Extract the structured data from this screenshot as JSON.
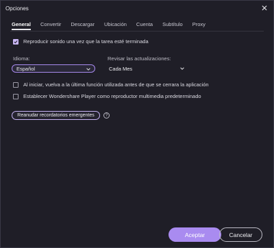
{
  "window": {
    "title": "Opciones",
    "close_icon": "close-icon"
  },
  "tabs": [
    {
      "label": "General",
      "active": true
    },
    {
      "label": "Convertir"
    },
    {
      "label": "Descargar"
    },
    {
      "label": "Ubicación"
    },
    {
      "label": "Cuenta"
    },
    {
      "label": "Subtítulo"
    },
    {
      "label": "Proxy"
    }
  ],
  "general": {
    "play_sound": {
      "label": "Reproducir sonido una vez que la tarea esté terminada",
      "checked": true
    },
    "language": {
      "label": "Idioma:",
      "value": "Español"
    },
    "updates": {
      "label": "Revisar las actualizaciones:",
      "value": "Cada Mes"
    },
    "resume_last": {
      "label": "Al iniciar, vuelva a la última función utilizada antes de que se cerrara la aplicación",
      "checked": false
    },
    "default_player": {
      "label": "Establecer Wondershare Player como reproductor multimedia predeterminado",
      "checked": false
    },
    "reset_popups": {
      "label": "Reanudar recordatorios emergentes"
    },
    "help_glyph": "?"
  },
  "footer": {
    "accept_label": "Aceptar",
    "cancel_label": "Cancelar"
  },
  "colors": {
    "accent": "#a98bf0",
    "background": "#1f1e27"
  }
}
